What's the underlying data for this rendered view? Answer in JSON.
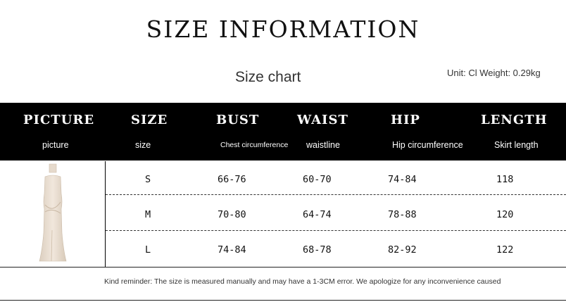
{
  "title": "SIZE INFORMATION",
  "subtitle": "Size chart",
  "unit_text": "Unit: Cl Weight: 0.29kg",
  "columns": [
    {
      "title": "PICTURE",
      "subtitle": "picture"
    },
    {
      "title": "SIZE",
      "subtitle": "size"
    },
    {
      "title": "BUST",
      "subtitle": "Chest circumference"
    },
    {
      "title": "WAIST",
      "subtitle": "waistline"
    },
    {
      "title": "HIP",
      "subtitle": "Hip circumference"
    },
    {
      "title": "LENGTH",
      "subtitle": "Skirt length"
    }
  ],
  "rows": [
    {
      "size": "S",
      "bust": "66-76",
      "waist": "60-70",
      "hip": "74-84",
      "length": "118"
    },
    {
      "size": "M",
      "bust": "70-80",
      "waist": "64-74",
      "hip": "78-88",
      "length": "120"
    },
    {
      "size": "L",
      "bust": "74-84",
      "waist": "68-78",
      "hip": "82-92",
      "length": "122"
    }
  ],
  "reminder": "Kind reminder: The size is measured manually and may have a 1-3CM error. We apologize for any inconvenience caused",
  "product_image": {
    "icon": "dress-image",
    "color": "#e9ddd0"
  }
}
